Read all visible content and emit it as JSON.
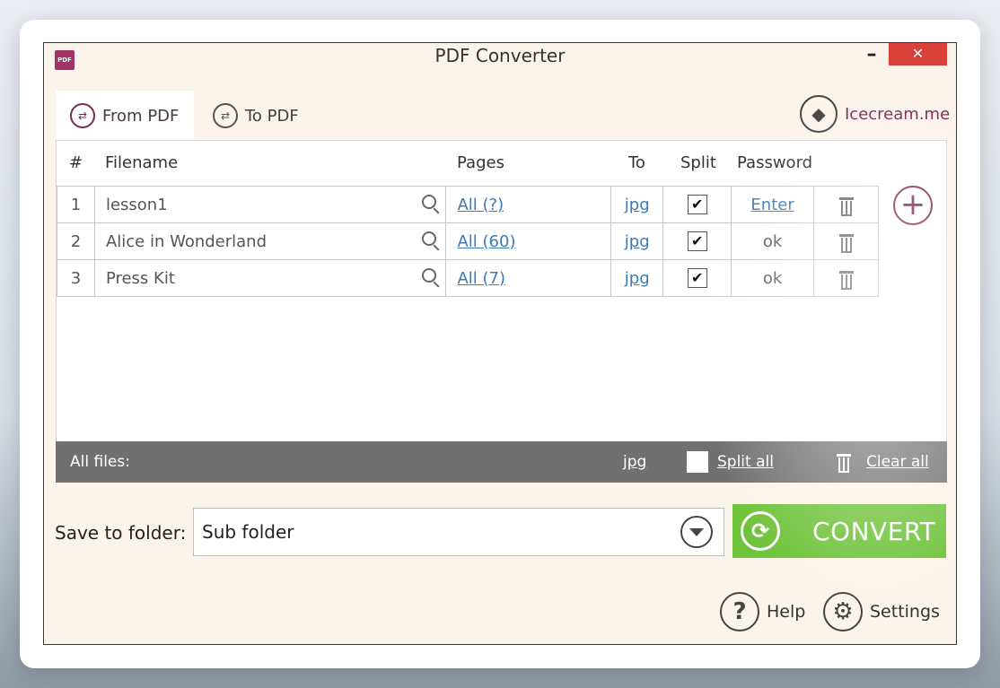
{
  "window": {
    "title": "PDF Converter",
    "app_icon_text": "PDF",
    "minimize_glyph": "–",
    "close_glyph": "✕"
  },
  "tabs": [
    {
      "label": "From PDF",
      "active": true,
      "icon": "from-pdf-icon"
    },
    {
      "label": "To PDF",
      "active": false,
      "icon": "to-pdf-icon"
    }
  ],
  "brand": {
    "label": "Icecream.me",
    "icon": "icecream-logo-icon"
  },
  "table": {
    "headers": {
      "num": "#",
      "filename": "Filename",
      "pages": "Pages",
      "to": "To",
      "split": "Split",
      "password": "Password"
    },
    "rows": [
      {
        "num": "1",
        "filename": "lesson1",
        "pages": "All (?)",
        "to": "jpg",
        "split": "✔",
        "password": "Enter",
        "password_is_link": true
      },
      {
        "num": "2",
        "filename": "Alice in Wonderland",
        "pages": "All (60)",
        "to": "jpg",
        "split": "✔",
        "password": "ok",
        "password_is_link": false
      },
      {
        "num": "3",
        "filename": "Press Kit",
        "pages": "All (7)",
        "to": "jpg",
        "split": "✔",
        "password": "ok",
        "password_is_link": false
      }
    ]
  },
  "add_button": {
    "glyph": "+"
  },
  "footer": {
    "all_files": "All files:",
    "format": "jpg",
    "split_all": "Split all",
    "clear_all": "Clear all"
  },
  "save": {
    "label": "Save to folder:",
    "value": "Sub folder"
  },
  "convert": {
    "label": "CONVERT",
    "glyph": "⟳"
  },
  "bottom": {
    "help": {
      "label": "Help",
      "glyph": "?"
    },
    "settings": {
      "label": "Settings",
      "glyph": "⚙"
    }
  },
  "colors": {
    "accent": "#7d2a54",
    "convert": "#6fc33b",
    "close": "#d9403a",
    "footbar": "#707070",
    "link": "#3d7ab8"
  }
}
